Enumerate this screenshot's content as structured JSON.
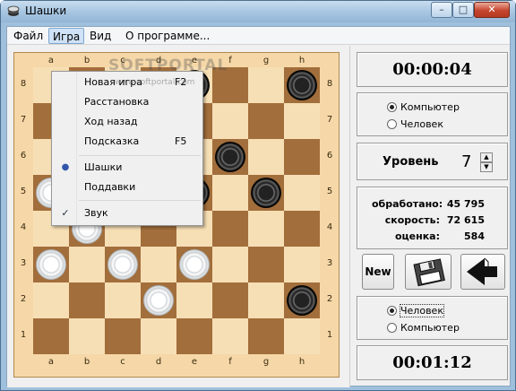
{
  "window": {
    "title": "Шашки",
    "min": "–",
    "max": "□",
    "close": "✕"
  },
  "menu": {
    "file": "Файл",
    "game": "Игра",
    "view": "Вид",
    "about": "О программе..."
  },
  "dropdown": {
    "items": [
      {
        "label": "Новая игра",
        "shortcut": "F2"
      },
      {
        "label": "Расстановка",
        "shortcut": ""
      },
      {
        "label": "Ход назад",
        "shortcut": ""
      },
      {
        "label": "Подсказка",
        "shortcut": "F5"
      },
      {
        "label": "Шашки",
        "shortcut": "",
        "mark": "●"
      },
      {
        "label": "Поддавки",
        "shortcut": ""
      },
      {
        "label": "Звук",
        "shortcut": "",
        "mark": "✓"
      }
    ]
  },
  "watermark": {
    "text": "SOFTPORTAL",
    "url": "www.softportal.com"
  },
  "board": {
    "files": [
      "a",
      "b",
      "c",
      "d",
      "e",
      "f",
      "g",
      "h"
    ],
    "ranks": [
      "8",
      "7",
      "6",
      "5",
      "4",
      "3",
      "2",
      "1"
    ],
    "pieces": [
      {
        "sq": "e8",
        "color": "b"
      },
      {
        "sq": "h8",
        "color": "b"
      },
      {
        "sq": "f6",
        "color": "b"
      },
      {
        "sq": "a5",
        "color": "w"
      },
      {
        "sq": "c5",
        "color": "b"
      },
      {
        "sq": "e5",
        "color": "b"
      },
      {
        "sq": "g5",
        "color": "b"
      },
      {
        "sq": "b4",
        "color": "w"
      },
      {
        "sq": "a3",
        "color": "w"
      },
      {
        "sq": "c3",
        "color": "w"
      },
      {
        "sq": "e3",
        "color": "w"
      },
      {
        "sq": "d2",
        "color": "w"
      },
      {
        "sq": "h2",
        "color": "b"
      }
    ]
  },
  "top_timer": "00:00:04",
  "top_player": {
    "options": [
      "Компьютер",
      "Человек"
    ],
    "selected": 0
  },
  "level": {
    "label": "Уровень",
    "value": "7",
    "up": "▲",
    "down": "▼"
  },
  "stats": [
    {
      "label": "обработано:",
      "value": "45 795"
    },
    {
      "label": "скорость:",
      "value": "72 615"
    },
    {
      "label": "оценка:",
      "value": "584"
    }
  ],
  "buttons": {
    "new": "New"
  },
  "bottom_player": {
    "options": [
      "Человек",
      "Компьютер"
    ],
    "selected": 0
  },
  "bottom_timer": "00:01:12"
}
